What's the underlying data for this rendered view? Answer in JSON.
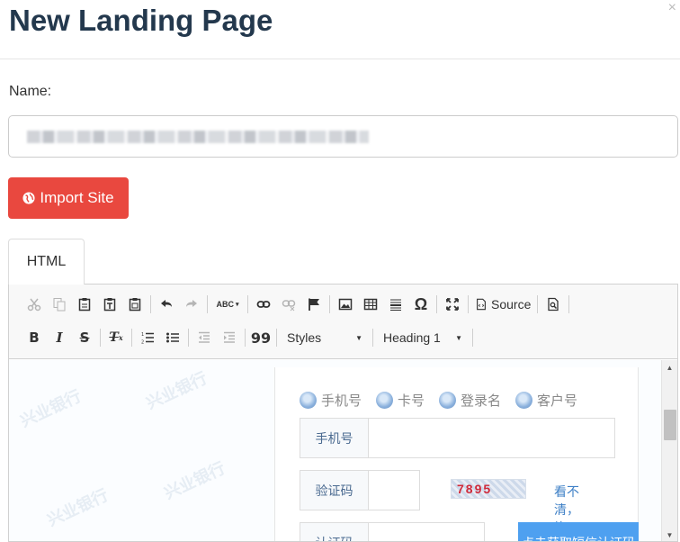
{
  "modal": {
    "title": "New Landing Page",
    "close": "×"
  },
  "form": {
    "name_label": "Name:",
    "name_value": "",
    "import_label": "Import Site"
  },
  "tabs": [
    {
      "label": "HTML"
    }
  ],
  "toolbar": {
    "row1": [
      "cut-icon",
      "copy-icon",
      "paste-icon",
      "paste-text-icon",
      "paste-word-icon",
      "undo-icon",
      "redo-icon",
      "spellcheck-icon",
      "link-icon",
      "unlink-icon",
      "anchor-icon",
      "image-icon",
      "table-icon",
      "horizontal-line-icon",
      "special-char-icon",
      "maximize-icon",
      "source-icon",
      "preview-icon"
    ],
    "spell_label": "ABC",
    "omega": "Ω",
    "source_label": "Source",
    "bold": "B",
    "italic": "I",
    "strike": "S",
    "remove_format": "Tx",
    "quote": "99",
    "styles_label": "Styles",
    "format_label": "Heading 1"
  },
  "content": {
    "watermark": "兴业银行",
    "login_types": [
      "手机号",
      "卡号",
      "登录名",
      "客户号"
    ],
    "fields": {
      "phone_label": "手机号",
      "captcha_label": "验证码",
      "captcha_text": "7895",
      "refresh_link": "看不清，换一张",
      "sms_label": "认证码",
      "sms_button": "点击获取短信认证码"
    }
  },
  "colors": {
    "title": "#23384d",
    "import_button": "#e9483f",
    "link": "#3d7fc6",
    "sms_button": "#4ea0f0"
  }
}
